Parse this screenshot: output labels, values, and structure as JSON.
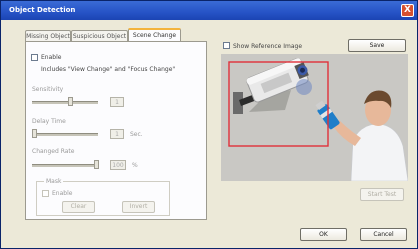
{
  "window": {
    "title": "Object Detection",
    "close_glyph": "X"
  },
  "tabs": [
    {
      "label": "Missing Object",
      "active": false
    },
    {
      "label": "Suspicious Object",
      "active": false
    },
    {
      "label": "Scene Change",
      "active": true
    }
  ],
  "scene_change": {
    "enable_label": "Enable",
    "enabled": false,
    "description": "Includes \"View Change\" and \"Focus Change\"",
    "sensitivity": {
      "label": "Sensitivity",
      "value": "1"
    },
    "delay_time": {
      "label": "Delay Time",
      "value": "1",
      "unit": "Sec."
    },
    "changed_rate": {
      "label": "Changed Rate",
      "value": "100",
      "unit": "%"
    },
    "mask": {
      "title": "Mask",
      "enable_label": "Enable",
      "clear_label": "Clear",
      "invert_label": "Invert"
    }
  },
  "preview": {
    "show_reference_label": "Show Reference Image",
    "save_label": "Save",
    "start_test_label": "Start Test"
  },
  "dialog": {
    "ok_label": "OK",
    "cancel_label": "Cancel"
  },
  "colors": {
    "title_bar": "#2653c6",
    "close_button": "#d6502f",
    "active_tab_accent": "#f3b33d",
    "detection_box": "#e0303a",
    "dialog_face": "#ece9d8"
  }
}
